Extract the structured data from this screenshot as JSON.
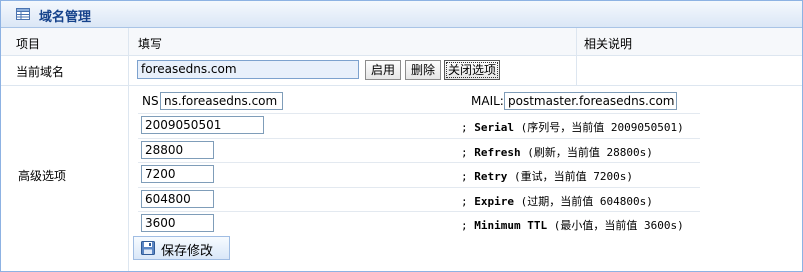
{
  "panel": {
    "title": "域名管理",
    "title_icon": "table-icon"
  },
  "columns": {
    "item": "项目",
    "fill": "填写",
    "description": "相关说明"
  },
  "domain_row": {
    "label": "当前域名",
    "value": "foreasedns.com",
    "enable_button": "启用",
    "delete_button": "删除",
    "close_options_button": "关闭选项"
  },
  "advanced": {
    "label": "高级选项",
    "ns_label": "NS:",
    "ns_value": "ns.foreasedns.com",
    "mail_label": "MAIL:",
    "mail_value": "postmaster.foreasedns.com",
    "fields": [
      {
        "value": "2009050501",
        "prefix": "; ",
        "name": "Serial",
        "desc": " (序列号，当前值 2009050501)"
      },
      {
        "value": "28800",
        "prefix": "; ",
        "name": "Refresh",
        "desc": " (刷新，当前值 28800s)"
      },
      {
        "value": "7200",
        "prefix": "; ",
        "name": "Retry",
        "desc": " (重试，当前值 7200s)"
      },
      {
        "value": "604800",
        "prefix": "; ",
        "name": "Expire",
        "desc": " (过期，当前值 604800s)"
      },
      {
        "value": "3600",
        "prefix": "; ",
        "name": "Minimum TTL",
        "desc": " (最小值，当前值 3600s)"
      }
    ],
    "save_button": "保存修改",
    "save_icon": "floppy-disk-icon"
  }
}
